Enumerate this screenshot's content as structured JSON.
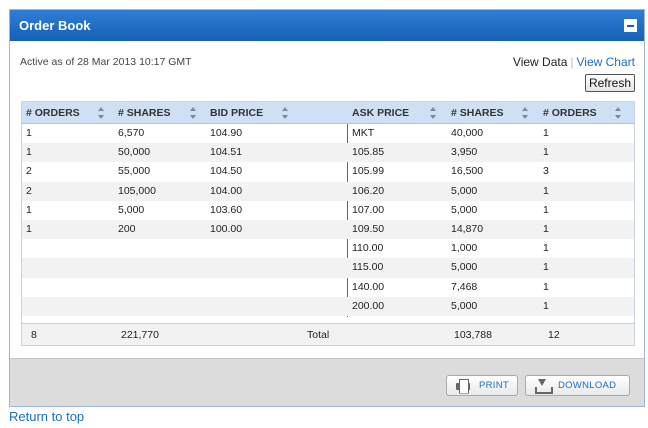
{
  "panel": {
    "title": "Order Book"
  },
  "meta": {
    "active_text": "Active as of 28 Mar 2013 10:17 GMT",
    "view_data": "View Data",
    "separator": "|",
    "view_chart": "View Chart",
    "refresh": "Refresh"
  },
  "columns": {
    "bid_orders": "# ORDERS",
    "bid_shares": "# SHARES",
    "bid_price": "BID PRICE",
    "ask_price": "ASK PRICE",
    "ask_shares": "# SHARES",
    "ask_orders": "# ORDERS"
  },
  "rows": [
    {
      "bid_orders": "1",
      "bid_shares": "6,570",
      "bid_price": "104.90",
      "ask_price": "MKT",
      "ask_shares": "40,000",
      "ask_orders": "1"
    },
    {
      "bid_orders": "1",
      "bid_shares": "50,000",
      "bid_price": "104.51",
      "ask_price": "105.85",
      "ask_shares": "3,950",
      "ask_orders": "1"
    },
    {
      "bid_orders": "2",
      "bid_shares": "55,000",
      "bid_price": "104.50",
      "ask_price": "105.99",
      "ask_shares": "16,500",
      "ask_orders": "3"
    },
    {
      "bid_orders": "2",
      "bid_shares": "105,000",
      "bid_price": "104.00",
      "ask_price": "106.20",
      "ask_shares": "5,000",
      "ask_orders": "1"
    },
    {
      "bid_orders": "1",
      "bid_shares": "5,000",
      "bid_price": "103.60",
      "ask_price": "107.00",
      "ask_shares": "5,000",
      "ask_orders": "1"
    },
    {
      "bid_orders": "1",
      "bid_shares": "200",
      "bid_price": "100.00",
      "ask_price": "109.50",
      "ask_shares": "14,870",
      "ask_orders": "1"
    },
    {
      "bid_orders": "",
      "bid_shares": "",
      "bid_price": "",
      "ask_price": "110.00",
      "ask_shares": "1,000",
      "ask_orders": "1"
    },
    {
      "bid_orders": "",
      "bid_shares": "",
      "bid_price": "",
      "ask_price": "115.00",
      "ask_shares": "5,000",
      "ask_orders": "1"
    },
    {
      "bid_orders": "",
      "bid_shares": "",
      "bid_price": "",
      "ask_price": "140.00",
      "ask_shares": "7,468",
      "ask_orders": "1"
    },
    {
      "bid_orders": "",
      "bid_shares": "",
      "bid_price": "",
      "ask_price": "200.00",
      "ask_shares": "5,000",
      "ask_orders": "1"
    }
  ],
  "totals": {
    "bid_orders": "8",
    "bid_shares": "221,770",
    "label": "Total",
    "ask_shares": "103,788",
    "ask_orders": "12"
  },
  "footer": {
    "print": "PRINT",
    "download": "DOWNLOAD"
  },
  "return_link": "Return to top",
  "colors": {
    "header": "#1660b8",
    "table_header": "#cfe0f5",
    "link": "#1a6fc7"
  }
}
